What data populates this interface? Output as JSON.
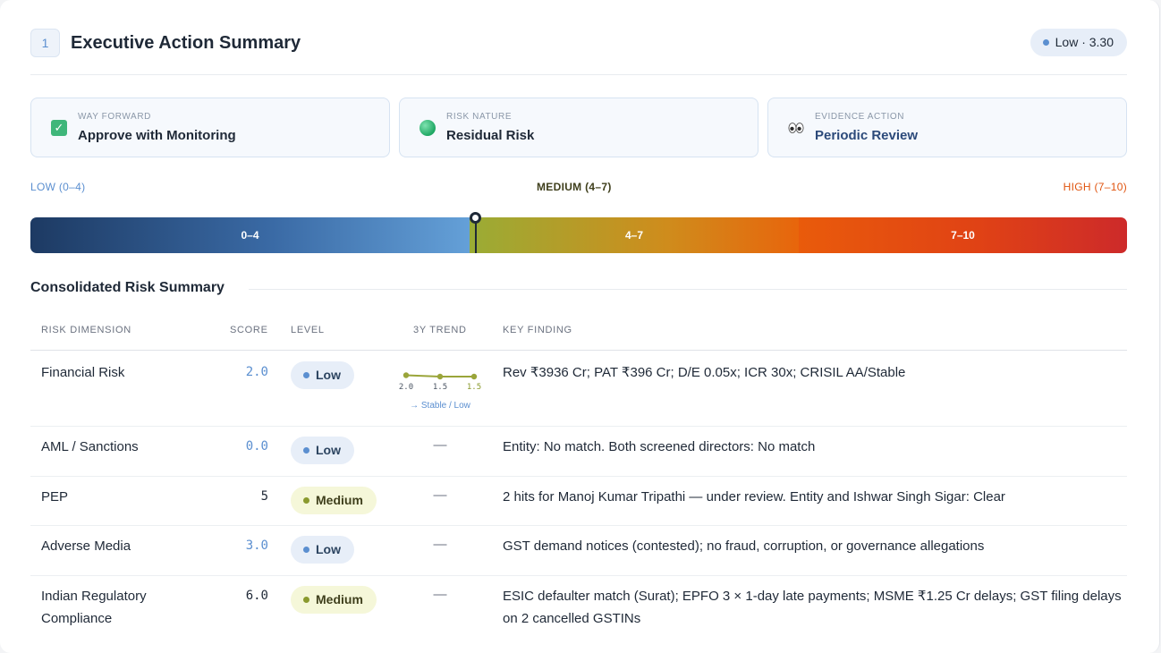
{
  "header": {
    "section_number": "1",
    "title": "Executive Action Summary",
    "score_pill": "Low · 3.30"
  },
  "boxes": [
    {
      "label": "WAY FORWARD",
      "value": "Approve with Monitoring",
      "icon": "check-icon",
      "value_color": "#1f2937"
    },
    {
      "label": "RISK NATURE",
      "value": "Residual Risk",
      "icon": "green-ball-icon",
      "value_color": "#1f2937"
    },
    {
      "label": "EVIDENCE ACTION",
      "value": "Periodic Review",
      "icon": "eyes-icon",
      "value_color": "#2c4a7a"
    }
  ],
  "scale": {
    "low_label": "LOW (0–4)",
    "medium_label": "MEDIUM (4–7)",
    "high_label": "HIGH (7–10)",
    "segments": [
      "0–4",
      "4–7",
      "7–10"
    ],
    "marker_value": 3.3,
    "colors": {
      "low": "#3a6aa5",
      "medium": "#cf8c1c",
      "high": "#e04215"
    }
  },
  "section": {
    "title": "Consolidated Risk Summary"
  },
  "table": {
    "headers": {
      "dimension": "RISK DIMENSION",
      "score": "SCORE",
      "level": "LEVEL",
      "trend": "3Y TREND",
      "finding": "KEY FINDING"
    },
    "rows": [
      {
        "dimension": "Financial Risk",
        "score": "2.0",
        "level": "Low",
        "trend": "",
        "finding": "Rev ₹3936 Cr; PAT ₹396 Cr; D/E 0.05x; ICR 30x; CRISIL AA/Stable"
      },
      {
        "dimension": "AML / Sanctions",
        "score": "0.0",
        "level": "Low",
        "trend": "—",
        "finding": "Entity: No match. Both screened directors: No match"
      },
      {
        "dimension": "PEP",
        "score": "5",
        "level": "Medium",
        "trend": "—",
        "finding": "2 hits for Manoj Kumar Tripathi — under review. Entity and Ishwar Singh Sigar: Clear"
      },
      {
        "dimension": "Adverse Media",
        "score": "3.0",
        "level": "Low",
        "trend": "—",
        "finding": "GST demand notices (contested); no fraud, corruption, or governance allegations"
      },
      {
        "dimension": "Indian Regulatory Compliance",
        "score": "6.0",
        "level": "Medium",
        "trend": "—",
        "finding": "ESIC defaulter match (Surat); EPFO 3 × 1-day late payments; MSME ₹1.25 Cr delays; GST filing delays on 2 cancelled GSTINs"
      }
    ],
    "financial_trend": {
      "values": [
        2.0,
        1.5,
        1.5
      ],
      "labels": [
        "2.0",
        "1.5",
        "1.5"
      ],
      "note": "→ Stable / Low",
      "color": "#9aa53a"
    }
  }
}
